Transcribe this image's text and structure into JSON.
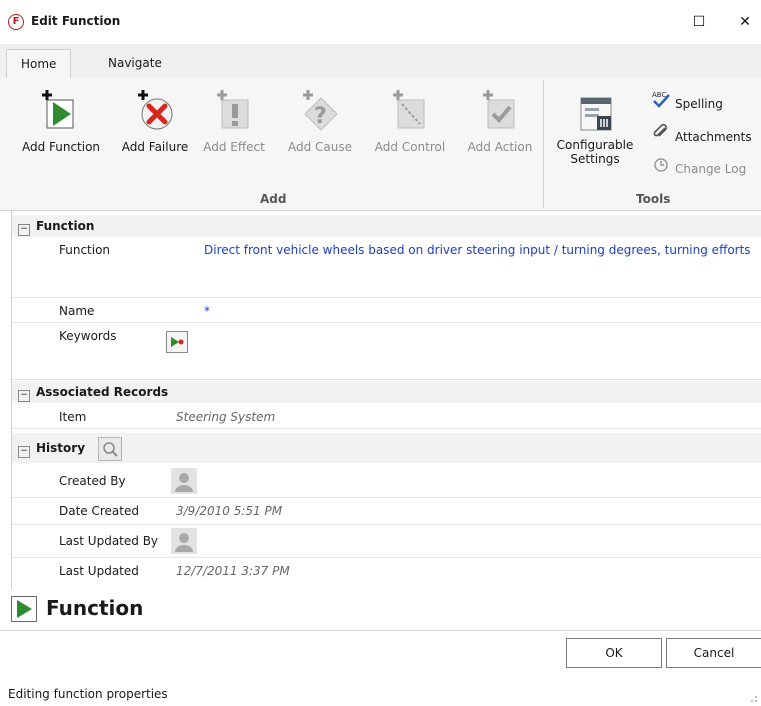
{
  "window": {
    "title": "Edit Function",
    "app_icon": "F",
    "maximize_glyph": "☐",
    "close_glyph": "✕"
  },
  "tabs": [
    {
      "label": "Home"
    },
    {
      "label": "Navigate"
    }
  ],
  "ribbon": {
    "add_group": {
      "label": "Add",
      "buttons": [
        {
          "label": "Add Function",
          "icon": "add-function-icon"
        },
        {
          "label": "Add Failure",
          "icon": "add-failure-icon"
        },
        {
          "label": "Add Effect",
          "icon": "add-effect-icon"
        },
        {
          "label": "Add Cause",
          "icon": "add-cause-icon"
        },
        {
          "label": "Add Control",
          "icon": "add-control-icon"
        },
        {
          "label": "Add Action",
          "icon": "add-action-icon"
        }
      ]
    },
    "tools_group": {
      "label": "Tools",
      "configurable_line1": "Configurable",
      "configurable_line2": "Settings",
      "spelling": "Spelling",
      "attachments": "Attachments",
      "change_log": "Change Log"
    }
  },
  "sections": {
    "function": {
      "title": "Function",
      "function_label": "Function",
      "function_value": "Direct front vehicle wheels based on driver steering input / turning degrees, turning efforts",
      "name_label": "Name",
      "name_value": "*",
      "keywords_label": "Keywords"
    },
    "associated": {
      "title": "Associated Records",
      "item_label": "Item",
      "item_value": "Steering System"
    },
    "history": {
      "title": "History",
      "created_by_label": "Created By",
      "date_created_label": "Date Created",
      "date_created_value": "3/9/2010 5:51 PM",
      "last_updated_by_label": "Last Updated By",
      "last_updated_label": "Last Updated",
      "last_updated_value": "12/7/2011 3:37 PM"
    }
  },
  "footer": {
    "title": "Function"
  },
  "buttons": {
    "ok": "OK",
    "cancel": "Cancel"
  },
  "status": "Editing function properties",
  "colors": {
    "accent_green": "#2e8b2e",
    "failure_red": "#d7261e",
    "link_blue": "#1b3ec9"
  }
}
